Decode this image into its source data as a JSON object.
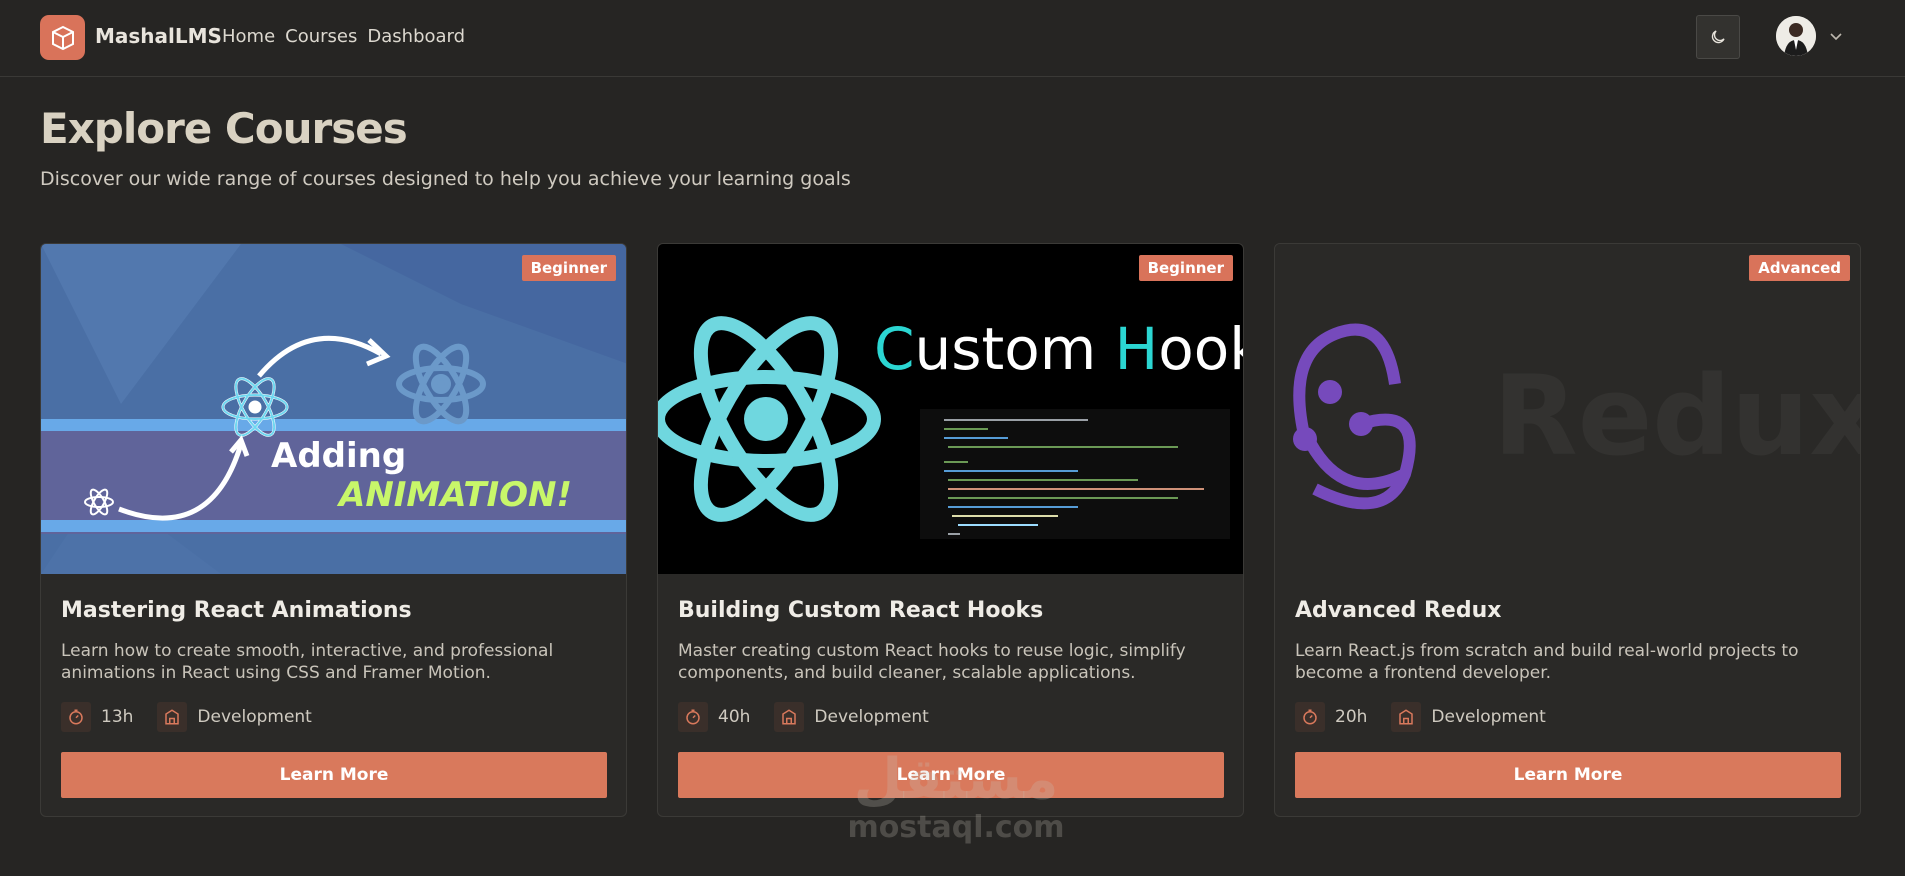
{
  "header": {
    "brand": "MashalLMS",
    "nav": [
      "Home",
      "Courses",
      "Dashboard"
    ]
  },
  "page": {
    "title": "Explore Courses",
    "subtitle": "Discover our wide range of courses designed to help you achieve your learning goals"
  },
  "courses": [
    {
      "level": "Beginner",
      "title": "Mastering React Animations",
      "description": "Learn how to create smooth, interactive, and professional animations in React using CSS and Framer Motion.",
      "duration": "13h",
      "category": "Development",
      "button": "Learn More",
      "image_text": [
        "Adding",
        "ANIMATION!"
      ]
    },
    {
      "level": "Beginner",
      "title": "Building Custom React Hooks",
      "description": "Master creating custom React hooks to reuse logic, simplify components, and build cleaner, scalable applications.",
      "duration": "40h",
      "category": "Development",
      "button": "Learn More",
      "image_text": [
        "C",
        "ustom ",
        "H",
        "ook"
      ]
    },
    {
      "level": "Advanced",
      "title": "Advanced Redux",
      "description": "Learn React.js from scratch and build real-world projects to become a frontend developer.",
      "duration": "20h",
      "category": "Development",
      "button": "Learn More",
      "image_text": [
        "Redux"
      ]
    }
  ],
  "watermark": {
    "arabic": "مستقل",
    "latin": "mostaql.com"
  },
  "colors": {
    "accent": "#d9795c",
    "background": "#262523",
    "card": "#2a2927"
  }
}
